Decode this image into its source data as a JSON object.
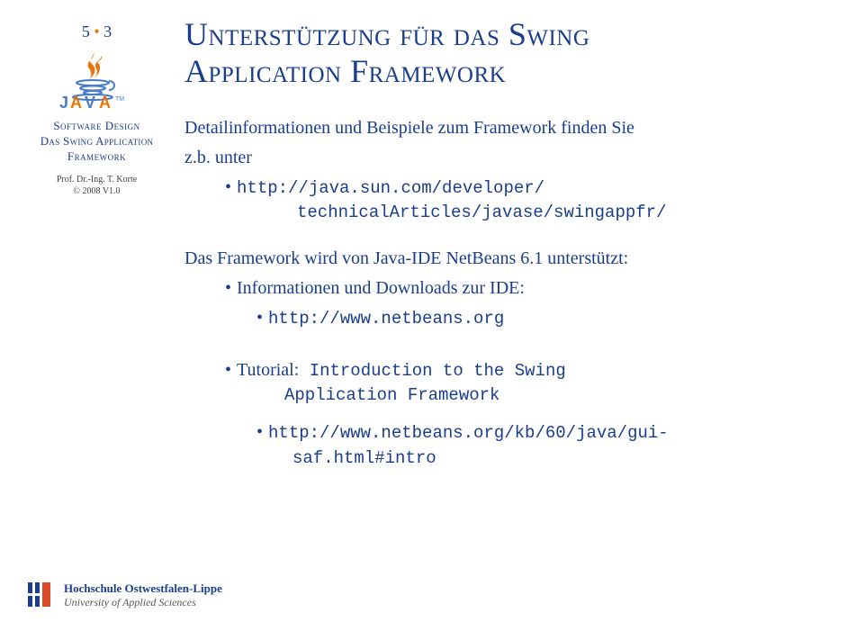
{
  "slide": {
    "number_prefix": "5",
    "number_suffix": "3"
  },
  "sidebar": {
    "course_line1": "Software Design",
    "course_line2": "Das Swing Application",
    "course_line3": "Framework",
    "author_line1": "Prof. Dr.-Ing. T. Korte",
    "author_line2": "© 2008 V1.0"
  },
  "title": {
    "line1": "Unterstützung für das Swing",
    "line2": "Application Framework"
  },
  "content": {
    "intro1": "Detailinformationen und Beispiele zum Framework finden Sie",
    "intro2": "z.b. unter",
    "link1a": "http://java.sun.com/developer/",
    "link1b": "technicalArticles/javase/swingappfr/",
    "mid1": "Das Framework wird von Java-IDE NetBeans 6.1 unterstützt:",
    "mid2": "Informationen und Downloads zur IDE:",
    "link2": "http://www.netbeans.org",
    "tutorial_label": "Tutorial:",
    "tutorial_rest1": " Introduction to the Swing",
    "tutorial_rest2": "Application Framework",
    "link3a": "http://www.netbeans.org/kb/60/java/gui-",
    "link3b": "saf.html#intro"
  },
  "footer": {
    "hs_name": "Hochschule Ostwestfalen-Lippe",
    "hs_sub": "University of Applied Sciences"
  }
}
